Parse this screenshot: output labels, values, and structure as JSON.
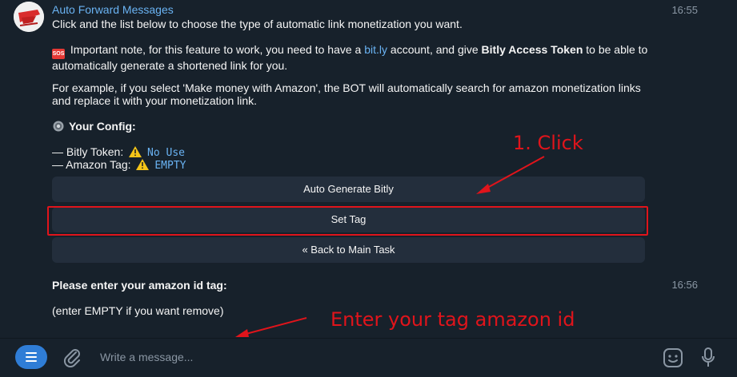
{
  "chat": {
    "sender": "Auto Forward Messages",
    "time1": "16:55",
    "line1": "Click and the list below to choose the type of automatic link monetization you want.",
    "note_part1": " Important note, for this feature to work, you need to have a ",
    "note_link": "bit.ly",
    "note_part2": " account, and give ",
    "note_bold": "Bitly Access Token",
    "note_part3": " to be able to automatically generate a shortened link for you.",
    "example": "For example, if you select 'Make money with Amazon', the BOT will automatically search for amazon monetization links and replace it with your monetization link.",
    "config_title": "Your Config:",
    "bitly_label": "— Bitly Token:",
    "bitly_value": "No Use",
    "amazon_label": "— Amazon Tag:",
    "amazon_value": "EMPTY",
    "sos_badge": "SOS"
  },
  "keyboard": {
    "btn1": "Auto Generate Bitly",
    "btn2": "Set Tag",
    "btn3": "« Back to Main Task"
  },
  "msg2": {
    "bold": "Please enter your amazon id tag:",
    "time": "16:56",
    "hint": "(enter EMPTY if you want remove)"
  },
  "annotations": {
    "click": "1. Click",
    "enter": "Enter your tag amazon id",
    "color": "#e0141b"
  },
  "composer": {
    "placeholder": "Write a message..."
  },
  "icons": [
    "menu-icon",
    "attach-icon",
    "sticker-icon",
    "microphone-icon",
    "gear-icon",
    "warning-icon",
    "sos-icon"
  ]
}
